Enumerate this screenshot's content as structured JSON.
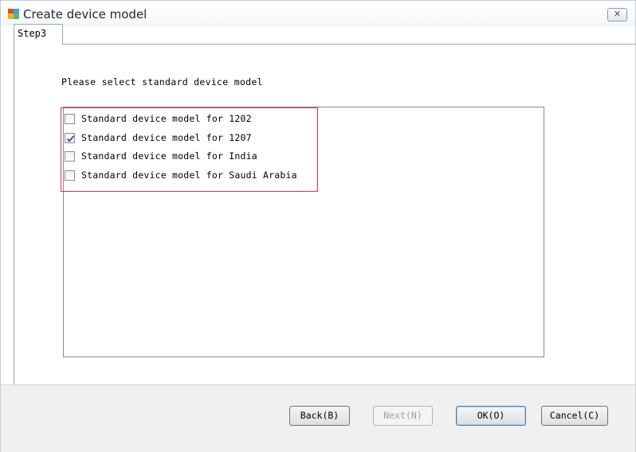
{
  "window": {
    "title": "Create device model",
    "close_glyph": "✕",
    "icon": "app-window-icon"
  },
  "tab": {
    "label": "Step3"
  },
  "prompt": "Please select standard device model",
  "options": [
    {
      "label": "Standard device model for 1202",
      "checked": false
    },
    {
      "label": "Standard device model for 1207",
      "checked": true
    },
    {
      "label": "Standard device model for India",
      "checked": false
    },
    {
      "label": "Standard device model for Saudi Arabia",
      "checked": false
    }
  ],
  "buttons": {
    "back": "Back(B)",
    "next": "Next(N)",
    "ok": "OK(O)",
    "cancel": "Cancel(C)"
  },
  "colors": {
    "highlight": "#e0303c",
    "check": "#2b4f8c"
  }
}
